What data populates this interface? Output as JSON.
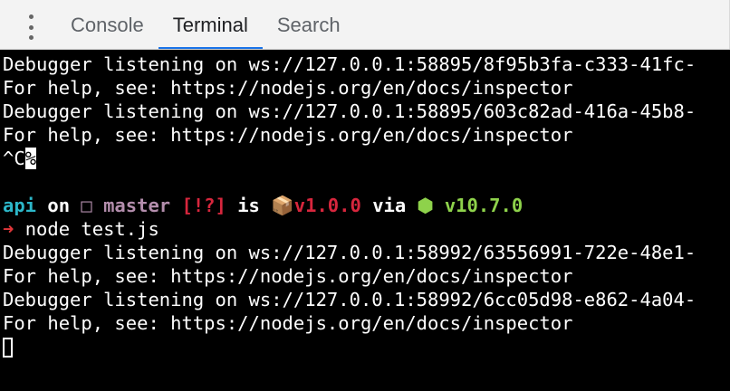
{
  "devtools": {
    "tabs": [
      {
        "label": "Console",
        "active": false
      },
      {
        "label": "Terminal",
        "active": true
      },
      {
        "label": "Search",
        "active": false
      }
    ],
    "menu_icon": "vertical-ellipsis-icon",
    "accent": "#1a73e8"
  },
  "terminal": {
    "lines": [
      "Debugger listening on ws://127.0.0.1:58895/8f95b3fa-c333-41fc-",
      "For help, see: https://nodejs.org/en/docs/inspector",
      "Debugger listening on ws://127.0.0.1:58895/603c82ad-416a-45b8-",
      "For help, see: https://nodejs.org/en/docs/inspector"
    ],
    "interrupt": {
      "caret": "^C",
      "marker": "%"
    },
    "prompt": {
      "dir": "api",
      "on": "on",
      "branch_icon": "□",
      "branch": "master",
      "status": "[!?]",
      "is": "is",
      "package_icon": "📦",
      "pkg_version": "v1.0.0",
      "via": "via",
      "node_icon": "⬢",
      "node_version": "v10.7.0",
      "arrow": "➜",
      "command": "node test.js"
    },
    "output": [
      "Debugger listening on ws://127.0.0.1:58992/63556991-722e-48e1-",
      "For help, see: https://nodejs.org/en/docs/inspector",
      "Debugger listening on ws://127.0.0.1:58992/6cc05d98-e862-4a04-",
      "For help, see: https://nodejs.org/en/docs/inspector"
    ],
    "colors": {
      "dir": "#2cb7c9",
      "branch": "#b48ead",
      "status": "#d7263d",
      "node": "#8ed24b"
    }
  }
}
